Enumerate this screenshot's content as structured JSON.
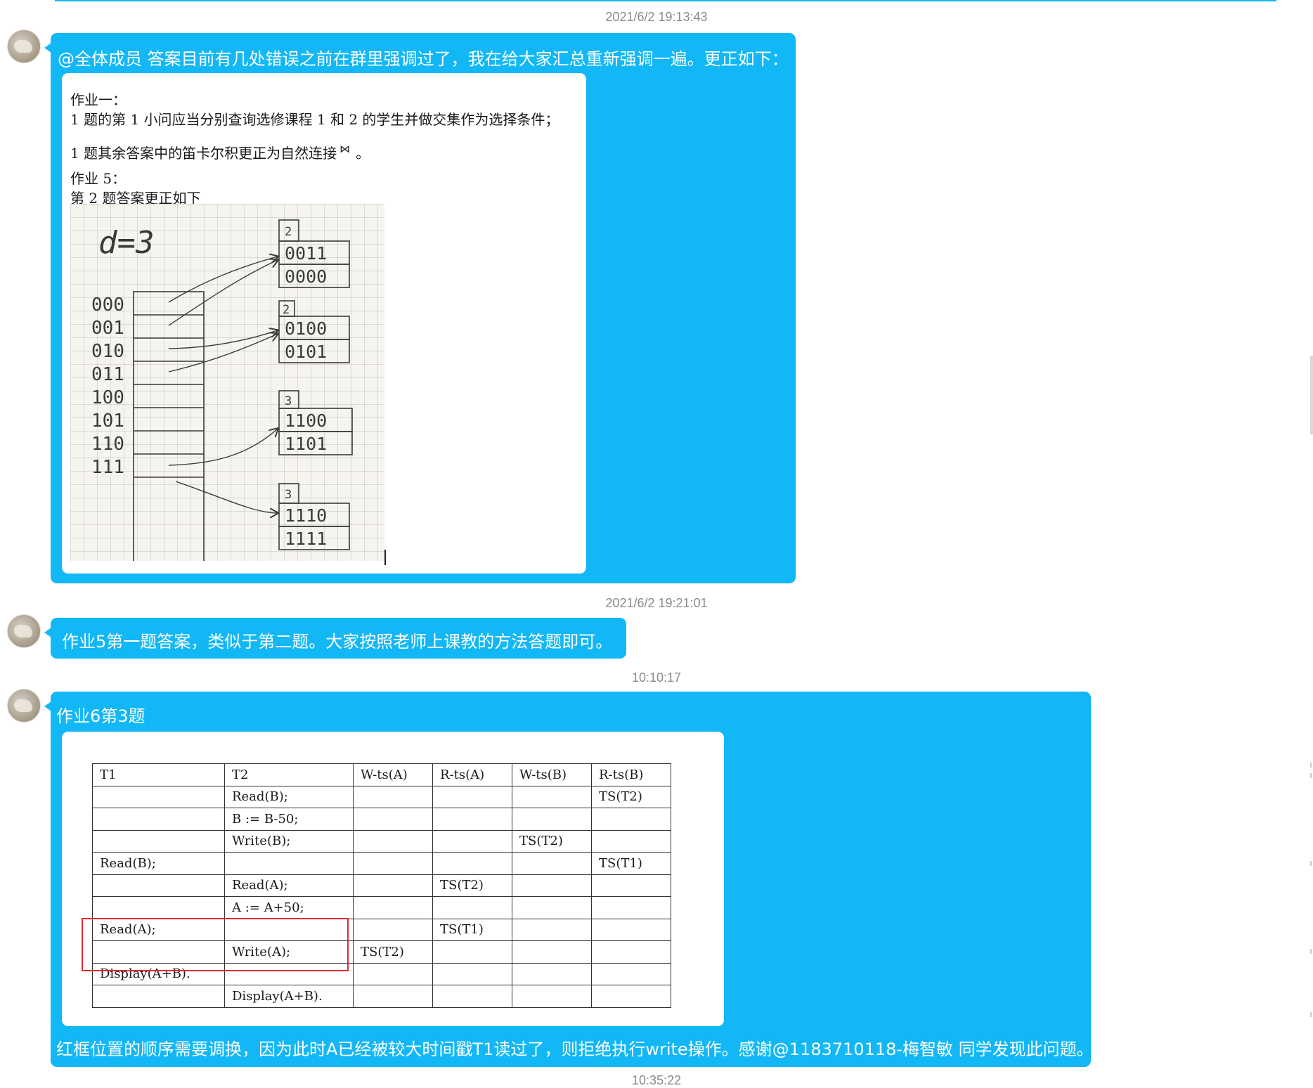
{
  "messages": [
    {
      "timestamp": "2021/6/2 19:13:43",
      "text": "@全体成员 答案目前有几处错误之前在群里强调过了，我在给大家汇总重新强调一遍。更正如下：",
      "card": {
        "lines": [
          "作业一：",
          "1 题的第 1 小问应当分别查询选修课程 1 和 2 的学生并做交集作为选择条件；",
          "1 题其余答案中的笛卡尔积更正为自然连接",
          "。",
          "作业 5：",
          "第 2 题答案更正如下"
        ],
        "join_symbol": "⋈",
        "diagram": {
          "depth_label": "d=3",
          "directory": [
            "000",
            "001",
            "010",
            "011",
            "100",
            "101",
            "110",
            "111"
          ],
          "buckets": [
            {
              "depth": "2",
              "entries": [
                "0011",
                "0000"
              ]
            },
            {
              "depth": "2",
              "entries": [
                "0100",
                "0101"
              ]
            },
            {
              "depth": "3",
              "entries": [
                "1100",
                "1101"
              ]
            },
            {
              "depth": "3",
              "entries": [
                "1110",
                "1111"
              ]
            }
          ]
        }
      }
    },
    {
      "timestamp": "2021/6/2 19:21:01",
      "text": "作业5第一题答案，类似于第二题。大家按照老师上课教的方法答题即可。"
    },
    {
      "timestamp": "10:10:17",
      "title": "作业6第3题",
      "table": {
        "headers": [
          "T1",
          "T2",
          "W-ts(A)",
          "R-ts(A)",
          "W-ts(B)",
          "R-ts(B)"
        ],
        "rows": [
          [
            "",
            "Read(B);",
            "",
            "",
            "",
            "TS(T2)"
          ],
          [
            "",
            "B := B-50;",
            "",
            "",
            "",
            ""
          ],
          [
            "",
            "Write(B);",
            "",
            "",
            "TS(T2)",
            ""
          ],
          [
            "Read(B);",
            "",
            "",
            "",
            "",
            "TS(T1)"
          ],
          [
            "",
            "Read(A);",
            "",
            "TS(T2)",
            "",
            ""
          ],
          [
            "",
            "A := A+50;",
            "",
            "",
            "",
            ""
          ],
          [
            "Read(A);",
            "",
            "",
            "TS(T1)",
            "",
            ""
          ],
          [
            "",
            "Write(A);",
            "TS(T2)",
            "",
            "",
            ""
          ],
          [
            "Display(A+B).",
            "",
            "",
            "",
            "",
            ""
          ],
          [
            "",
            "Display(A+B).",
            "",
            "",
            "",
            ""
          ]
        ]
      },
      "text": "红框位置的顺序需要调换，因为此时A已经被较大时间戳T1读过了，则拒绝执行write操作。感谢@1183710118-梅智敏 同学发现此问题。"
    }
  ],
  "next_timestamp": "10:35:22",
  "colors": {
    "bubble": "#12b7f5",
    "timestamp": "#8a8a8a",
    "highlight": "#e02b2b"
  }
}
